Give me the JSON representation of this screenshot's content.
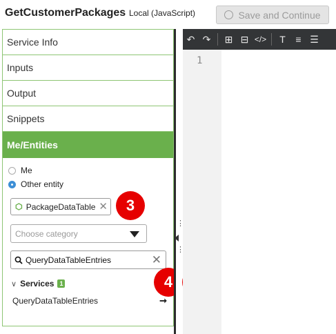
{
  "header": {
    "title": "GetCustomerPackages",
    "subtitle": "Local (JavaScript)",
    "save_label": "Save and Continue"
  },
  "nav": {
    "items": [
      {
        "label": "Service Info"
      },
      {
        "label": "Inputs"
      },
      {
        "label": "Output"
      },
      {
        "label": "Snippets"
      },
      {
        "label": "Me/Entities"
      }
    ],
    "active_index": 4
  },
  "entities": {
    "radio_me": "Me",
    "radio_other": "Other entity",
    "selected": "Other entity",
    "entity_chip_label": "PackageDataTable",
    "category_placeholder": "Choose category",
    "search_value": "QueryDataTableEntries",
    "services_label": "Services",
    "services_count": "1",
    "service_items": [
      {
        "label": "QueryDataTableEntries"
      }
    ]
  },
  "callouts": {
    "c3": "3",
    "c4": "4"
  },
  "editor": {
    "line_numbers": [
      "1"
    ],
    "toolbar_icons": [
      "undo-icon",
      "redo-icon",
      "insert-snippet-icon",
      "comment-icon",
      "code-icon",
      "text-size-icon",
      "align-icon",
      "indent-icon"
    ]
  },
  "colors": {
    "accent_green": "#6ab04c",
    "border_green": "#8dc573",
    "callout_red": "#e60000",
    "toolbar_dark": "#333537"
  }
}
